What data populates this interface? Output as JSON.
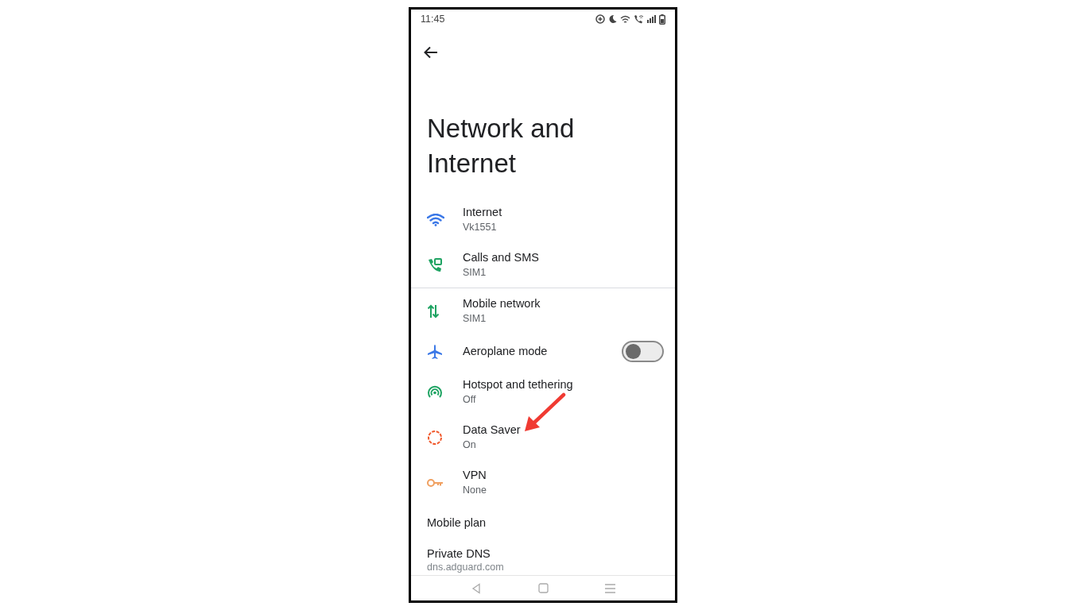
{
  "status_bar": {
    "time": "11:45"
  },
  "title": "Network and Internet",
  "groups": [
    [
      {
        "kind": "entry",
        "title": "Internet",
        "subtitle": "Vk1551"
      },
      {
        "kind": "entry",
        "title": "Calls and SMS",
        "subtitle": "SIM1"
      }
    ],
    [
      {
        "kind": "entry",
        "title": "Mobile network",
        "subtitle": "SIM1"
      },
      {
        "kind": "toggle",
        "title": "Aeroplane mode",
        "on": false
      },
      {
        "kind": "entry",
        "title": "Hotspot and tethering",
        "subtitle": "Off"
      },
      {
        "kind": "entry",
        "title": "Data Saver",
        "subtitle": "On"
      },
      {
        "kind": "entry",
        "title": "VPN",
        "subtitle": "None"
      },
      {
        "kind": "plain",
        "title": "Mobile plan"
      },
      {
        "kind": "plain",
        "title": "Private DNS",
        "subtitle": "dns.adguard.com"
      }
    ]
  ]
}
